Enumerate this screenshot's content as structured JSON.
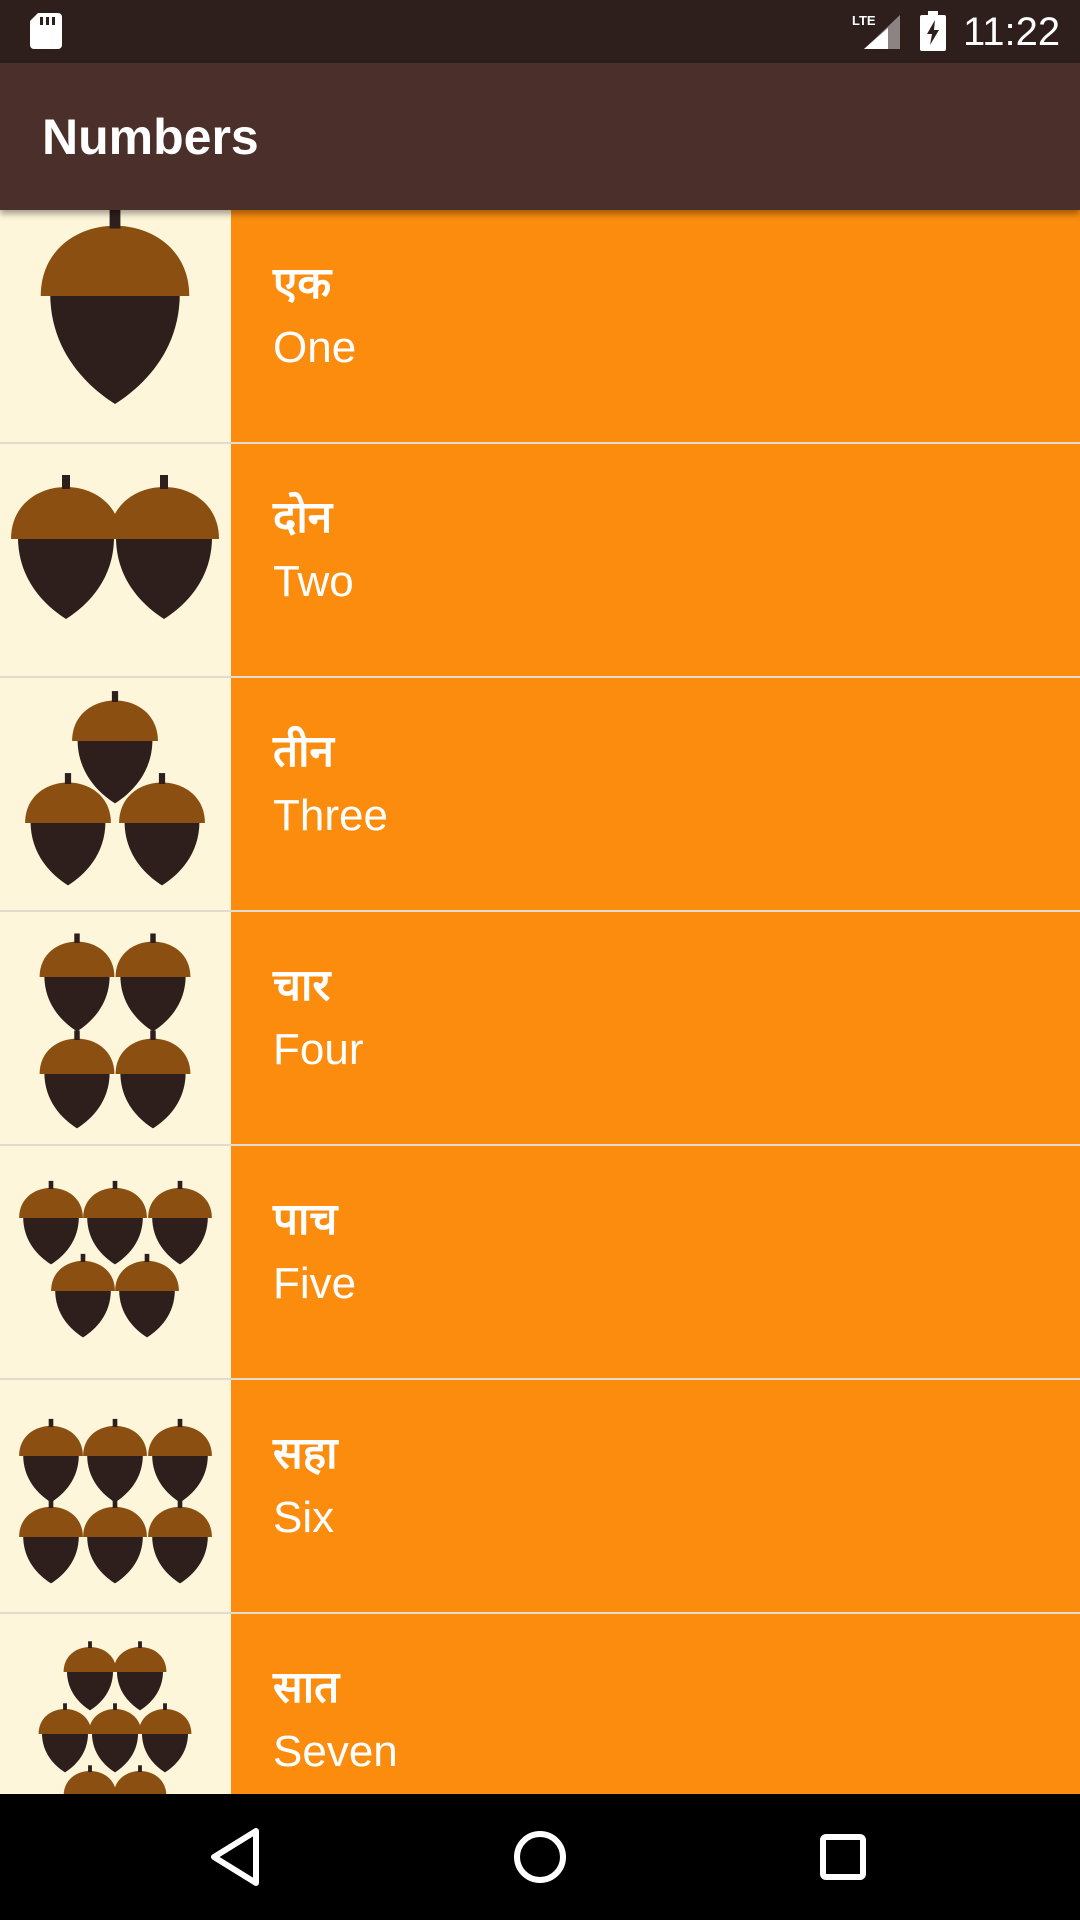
{
  "status_bar": {
    "time": "11:22",
    "network_label": "LTE",
    "icons": [
      "sd-card-icon",
      "signal-icon",
      "battery-charging-icon"
    ]
  },
  "app_bar": {
    "title": "Numbers"
  },
  "colors": {
    "status_bar": "#2E1F1D",
    "app_bar": "#4A2F2A",
    "row_background": "#FB8C0E",
    "thumb_background": "#FEF6DA",
    "acorn_cap": "#8B4F11",
    "acorn_body": "#2E1F1D",
    "nav_bar": "#000000"
  },
  "numbers": [
    {
      "hindi": "एक",
      "english": "One",
      "image": "number-one-acorns-icon",
      "acorn_count": 1
    },
    {
      "hindi": "दोन",
      "english": "Two",
      "image": "number-two-acorns-icon",
      "acorn_count": 2
    },
    {
      "hindi": "तीन",
      "english": "Three",
      "image": "number-three-acorns-icon",
      "acorn_count": 3
    },
    {
      "hindi": "चार",
      "english": "Four",
      "image": "number-four-acorns-icon",
      "acorn_count": 4
    },
    {
      "hindi": "पाच",
      "english": "Five",
      "image": "number-five-acorns-icon",
      "acorn_count": 5
    },
    {
      "hindi": "सहा",
      "english": "Six",
      "image": "number-six-acorns-icon",
      "acorn_count": 6
    },
    {
      "hindi": "सात",
      "english": "Seven",
      "image": "number-seven-acorns-icon",
      "acorn_count": 7
    }
  ],
  "nav_bar": {
    "buttons": [
      "back-icon",
      "home-icon",
      "recents-icon"
    ]
  }
}
